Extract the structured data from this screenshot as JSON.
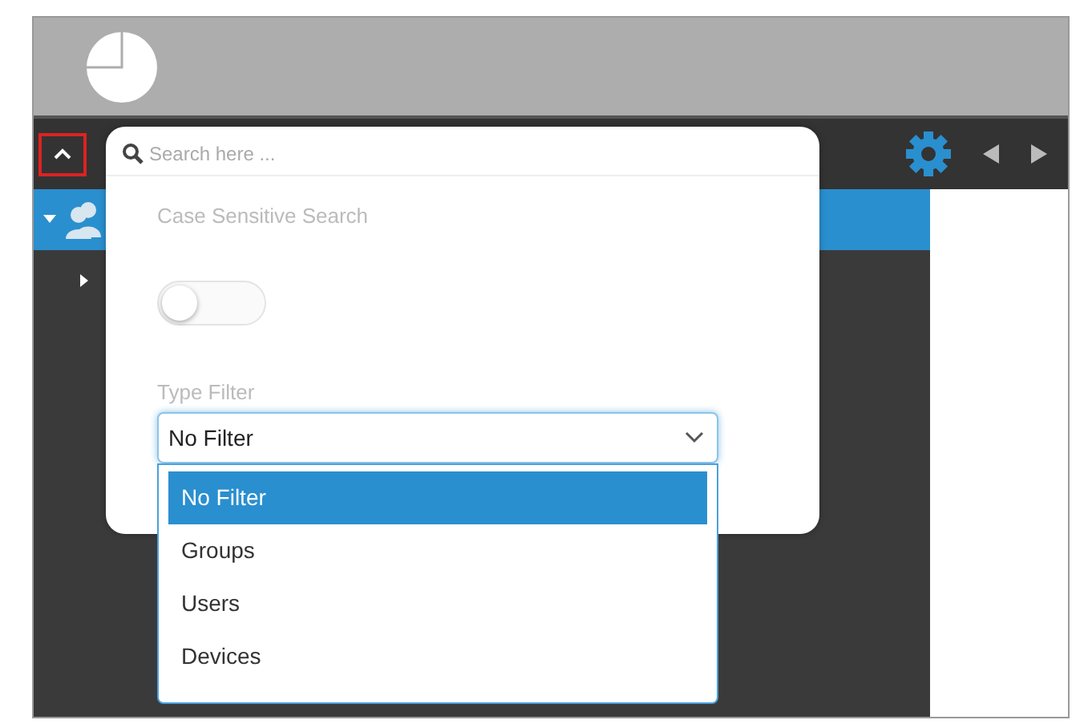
{
  "tree": {
    "items": [
      {
        "expanded": true,
        "selected": true,
        "children": [
          {
            "expanded": false,
            "selected": false
          }
        ]
      }
    ]
  },
  "search": {
    "placeholder": "Search here ..."
  },
  "case_sensitive": {
    "label": "Case Sensitive Search",
    "on": false
  },
  "type_filter": {
    "label": "Type Filter",
    "value": "No Filter",
    "open": true,
    "options": [
      {
        "label": "No Filter",
        "selected": true
      },
      {
        "label": "Groups",
        "selected": false
      },
      {
        "label": "Users",
        "selected": false
      },
      {
        "label": "Devices",
        "selected": false
      }
    ]
  }
}
